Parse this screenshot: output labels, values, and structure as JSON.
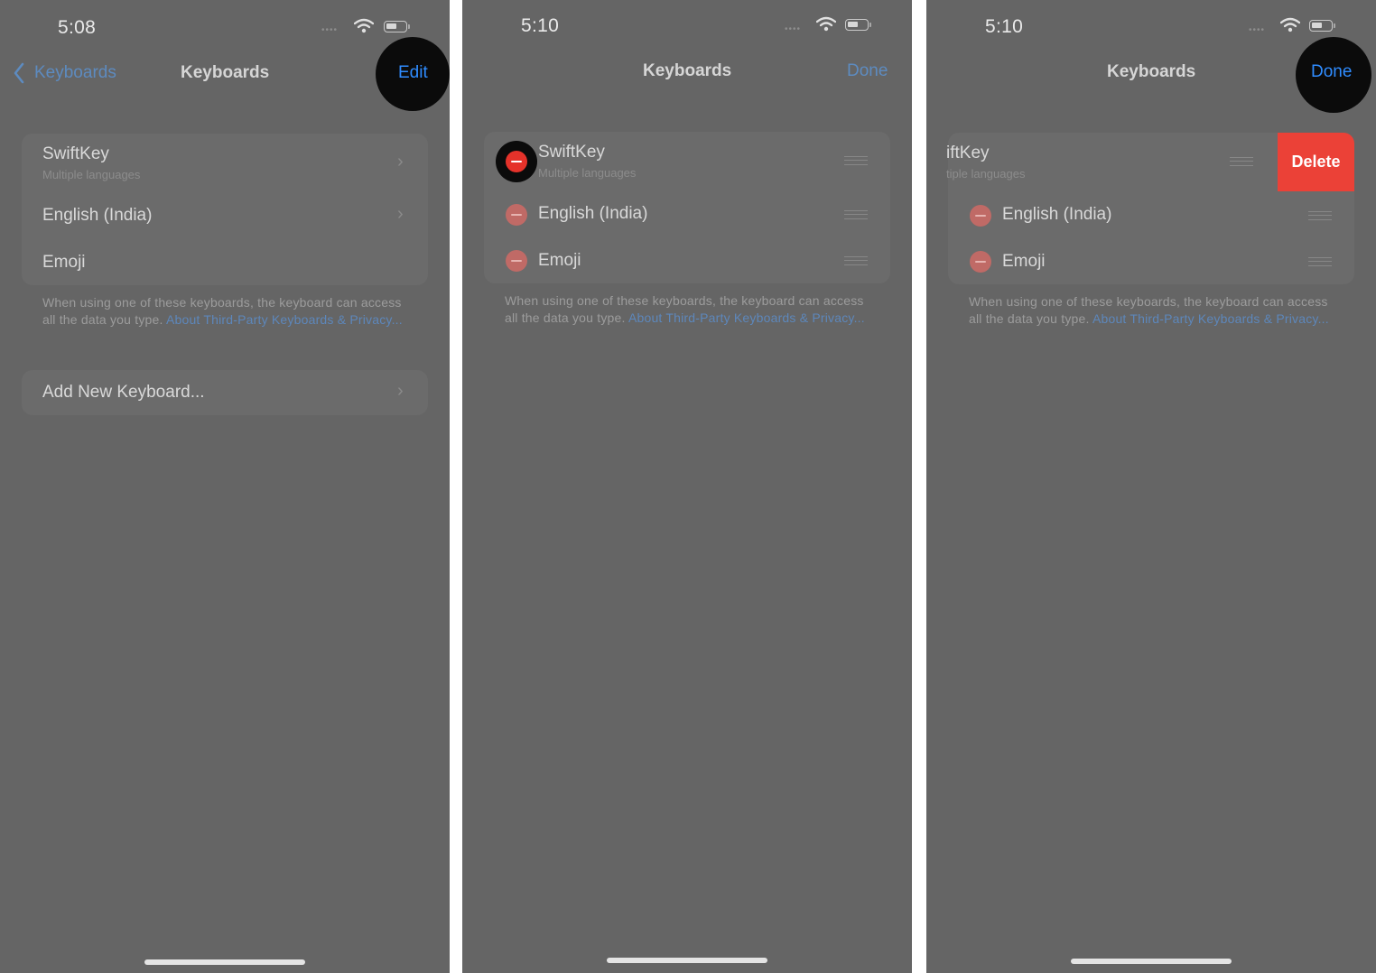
{
  "panel1": {
    "time": "5:08",
    "nav_back_label": "Keyboards",
    "nav_title": "Keyboards",
    "nav_edit_label": "Edit",
    "keyboards": [
      {
        "title": "SwiftKey",
        "subtitle": "Multiple languages"
      },
      {
        "title": "English (India)"
      },
      {
        "title": "Emoji"
      }
    ],
    "footer_text": "When using one of these keyboards, the keyboard can access",
    "footer_text2": "all the data you type.",
    "footer_link": "About Third-Party Keyboards & Privacy...",
    "add_keyboard_label": "Add New Keyboard..."
  },
  "panel2": {
    "time": "5:10",
    "nav_title": "Keyboards",
    "nav_done_label": "Done",
    "keyboards": [
      {
        "title": "SwiftKey",
        "subtitle": "Multiple languages"
      },
      {
        "title": "English (India)"
      },
      {
        "title": "Emoji"
      }
    ],
    "footer_text": "When using one of these keyboards, the keyboard can access",
    "footer_text2": "all the data you type.",
    "footer_link": "About Third-Party Keyboards & Privacy..."
  },
  "panel3": {
    "time": "5:10",
    "nav_title": "Keyboards",
    "nav_done_label": "Done",
    "keyboards": [
      {
        "title": "iftKey",
        "subtitle": "tiple languages"
      },
      {
        "title": "English (India)"
      },
      {
        "title": "Emoji"
      }
    ],
    "delete_label": "Delete",
    "footer_text": "When using one of these keyboards, the keyboard can access",
    "footer_text2": "all the data you type.",
    "footer_link": "About Third-Party Keyboards & Privacy..."
  },
  "icons": {
    "cellular": "signal-dots-icon",
    "wifi": "wifi-icon",
    "battery": "battery-icon",
    "back": "chevron-left-icon",
    "disclosure": "chevron-right-icon",
    "remove": "minus-circle-icon",
    "reorder": "reorder-handle-icon"
  },
  "colors": {
    "dim_background": "#656565",
    "link_blue": "#2f8cff",
    "delete_red": "#eb4137",
    "remove_red": "#e5322a"
  }
}
